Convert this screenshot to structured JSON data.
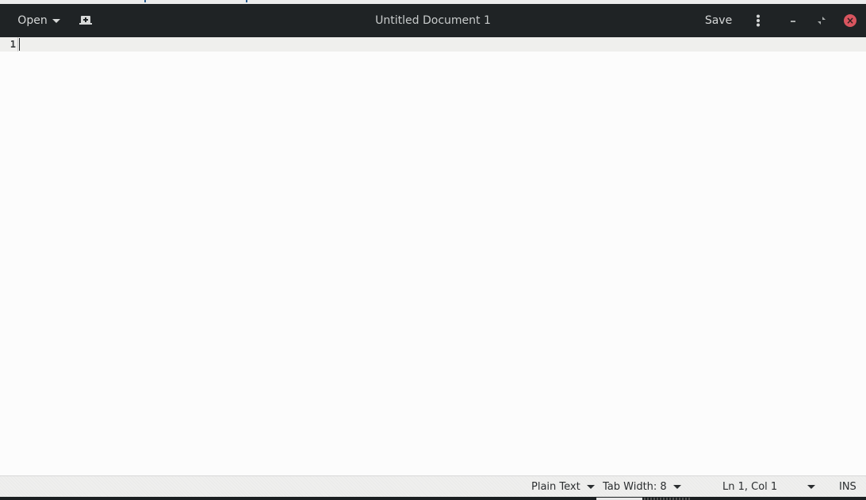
{
  "window": {
    "title": "Untitled Document 1"
  },
  "headerbar": {
    "open_label": "Open",
    "new_document_icon": "new-document-icon",
    "save_label": "Save",
    "menu_icon": "vertical-ellipsis-icon",
    "minimize_icon": "minimize-icon",
    "maximize_icon": "restore-icon",
    "close_icon": "close-icon",
    "close_color": "#d9555f"
  },
  "editor": {
    "line_numbers": [
      "1"
    ],
    "content": "",
    "current_line": 1
  },
  "statusbar": {
    "language": "Plain Text",
    "tab_width": "Tab Width: 8",
    "position": "Ln 1, Col 1",
    "mode": "INS"
  }
}
